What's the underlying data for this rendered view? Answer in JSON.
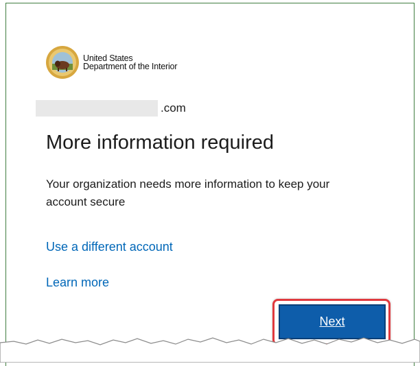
{
  "org": {
    "name_line1": "United States",
    "name_line2": "Department of the Interior",
    "logo_icon": "doi-seal-icon"
  },
  "account": {
    "email_suffix": ".com"
  },
  "main": {
    "title": "More information required",
    "description": "Your organization needs more information to keep your account secure"
  },
  "links": {
    "use_different_account": "Use a different account",
    "learn_more": "Learn more"
  },
  "actions": {
    "next_label": "Next"
  },
  "colors": {
    "link": "#0067b8",
    "primary_button": "#0e5daa",
    "highlight": "#e0393e",
    "frame_border": "#3f7d3f"
  }
}
